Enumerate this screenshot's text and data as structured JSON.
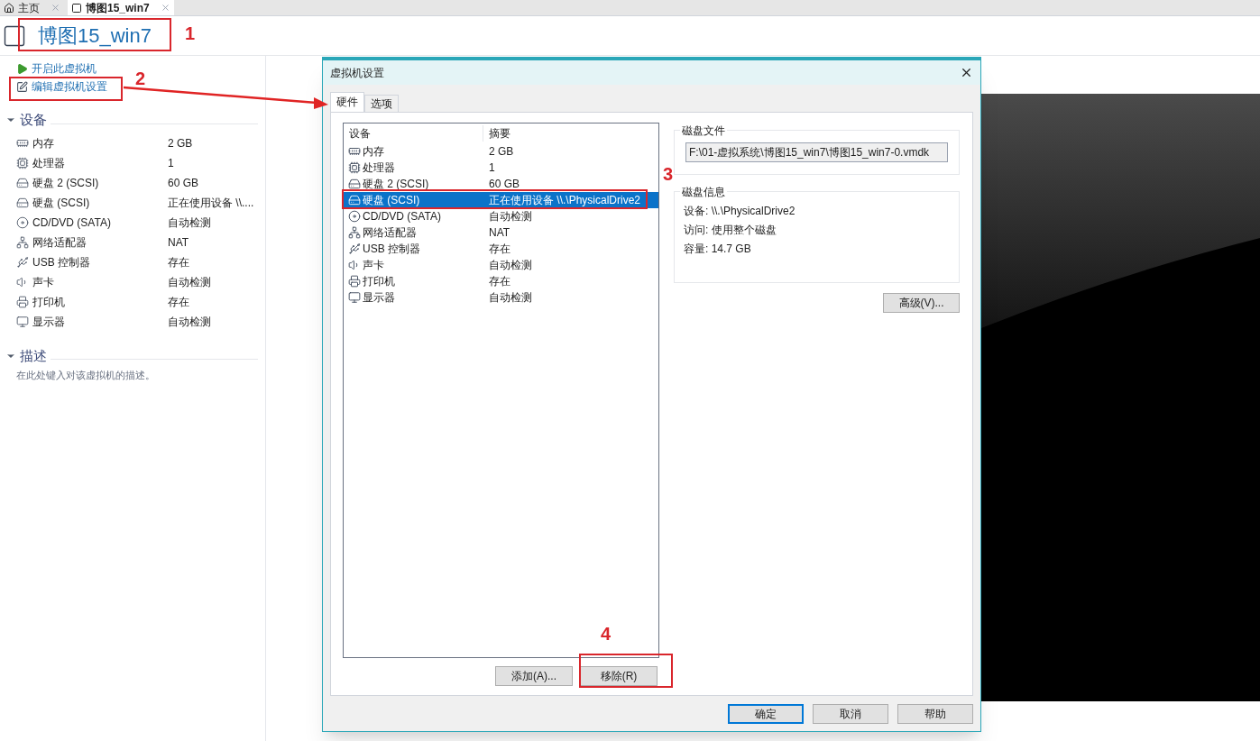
{
  "tabs": [
    {
      "label": "主页",
      "selected": false
    },
    {
      "label": "博图15_win7",
      "selected": true
    }
  ],
  "vm_title": "博图15_win7",
  "actions": [
    {
      "kind": "play",
      "label": "开启此虚拟机"
    },
    {
      "kind": "edit",
      "label": "编辑虚拟机设置"
    }
  ],
  "devices_section": {
    "title": "设备",
    "expanded": true,
    "items": [
      {
        "kind": "memory",
        "name": "内存",
        "summary": "2 GB"
      },
      {
        "kind": "cpu",
        "name": "处理器",
        "summary": "1"
      },
      {
        "kind": "disk",
        "name": "硬盘 2 (SCSI)",
        "summary": "60 GB"
      },
      {
        "kind": "disk",
        "name": "硬盘 (SCSI)",
        "summary": "正在使用设备 \\\\...."
      },
      {
        "kind": "cdrom",
        "name": "CD/DVD (SATA)",
        "summary": "自动检测"
      },
      {
        "kind": "network",
        "name": "网络适配器",
        "summary": "NAT"
      },
      {
        "kind": "usb",
        "name": "USB 控制器",
        "summary": "存在"
      },
      {
        "kind": "sound",
        "name": "声卡",
        "summary": "自动检测"
      },
      {
        "kind": "printer",
        "name": "打印机",
        "summary": "存在"
      },
      {
        "kind": "display",
        "name": "显示器",
        "summary": "自动检测"
      }
    ]
  },
  "description_section": {
    "title": "描述",
    "expanded": true,
    "placeholder": "在此处键入对该虚拟机的描述。"
  },
  "dialog": {
    "title": "虚拟机设置",
    "tabs": [
      {
        "label": "硬件",
        "selected": true
      },
      {
        "label": "选项",
        "selected": false
      }
    ],
    "columns": [
      "设备",
      "摘要"
    ],
    "rows": [
      {
        "kind": "memory",
        "name": "内存",
        "summary": "2 GB",
        "selected": false
      },
      {
        "kind": "cpu",
        "name": "处理器",
        "summary": "1",
        "selected": false
      },
      {
        "kind": "disk",
        "name": "硬盘 2 (SCSI)",
        "summary": "60 GB",
        "selected": false
      },
      {
        "kind": "disk",
        "name": "硬盘 (SCSI)",
        "summary": "正在使用设备 \\\\.\\PhysicalDrive2",
        "selected": true
      },
      {
        "kind": "cdrom",
        "name": "CD/DVD (SATA)",
        "summary": "自动检测",
        "selected": false
      },
      {
        "kind": "network",
        "name": "网络适配器",
        "summary": "NAT",
        "selected": false
      },
      {
        "kind": "usb",
        "name": "USB 控制器",
        "summary": "存在",
        "selected": false
      },
      {
        "kind": "sound",
        "name": "声卡",
        "summary": "自动检测",
        "selected": false
      },
      {
        "kind": "printer",
        "name": "打印机",
        "summary": "存在",
        "selected": false
      },
      {
        "kind": "display",
        "name": "显示器",
        "summary": "自动检测",
        "selected": false
      }
    ],
    "list_buttons": [
      "添加(A)...",
      "移除(R)"
    ],
    "disk_file": {
      "title": "磁盘文件",
      "value": "F:\\01-虚拟系统\\博图15_win7\\博图15_win7-0.vmdk"
    },
    "disk_info": {
      "title": "磁盘信息",
      "lines": [
        "设备: \\\\.\\PhysicalDrive2",
        "访问: 使用整个磁盘",
        "容量: 14.7 GB"
      ]
    },
    "advanced_button": "高级(V)...",
    "footer_buttons": [
      {
        "label": "确定",
        "default": true
      },
      {
        "label": "取消",
        "default": false
      },
      {
        "label": "帮助",
        "default": false
      }
    ]
  },
  "annotations": [
    "1",
    "2",
    "3",
    "4"
  ]
}
